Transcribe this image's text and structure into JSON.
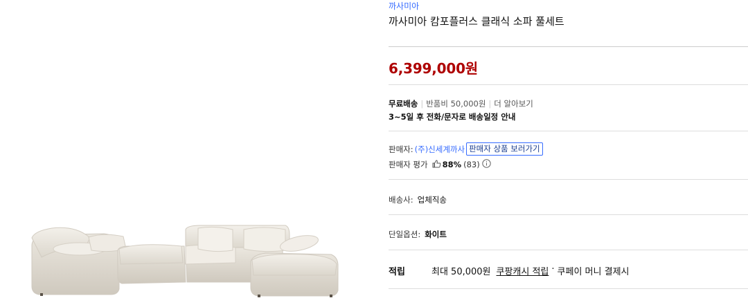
{
  "product": {
    "brand": "까사미아",
    "title": "까사미아 캄포플러스 클래식 소파 풀세트",
    "price": "6,399,000원"
  },
  "shipping": {
    "free_label": "무료배송",
    "return_fee": "반품비 50,000원",
    "more_label": "더 알아보기",
    "schedule": "3~5일 후 전화/문자로 배송일정 안내"
  },
  "seller": {
    "label": "판매자:",
    "name": "(주)신세계까사",
    "view_button": "판매자 상품 보러가기",
    "rating_label": "판매자 평가",
    "rating_percent": "88%",
    "rating_count": "(83)"
  },
  "carrier": {
    "label": "배송사:",
    "value": "업체직송"
  },
  "option": {
    "label": "단일옵션:",
    "value": "화이트"
  },
  "points": {
    "label": "적립",
    "max_text": "최대 50,000원",
    "cash_link": "쿠팡캐시 적립",
    "dot": "·",
    "pay_text": "쿠페이 머니 결제시"
  },
  "colors": {
    "brand_link": "#346aff",
    "price": "#ae0000",
    "sofa": "#ebe7df"
  },
  "icons": [
    "thumbs-up-icon",
    "info-circle-icon"
  ]
}
